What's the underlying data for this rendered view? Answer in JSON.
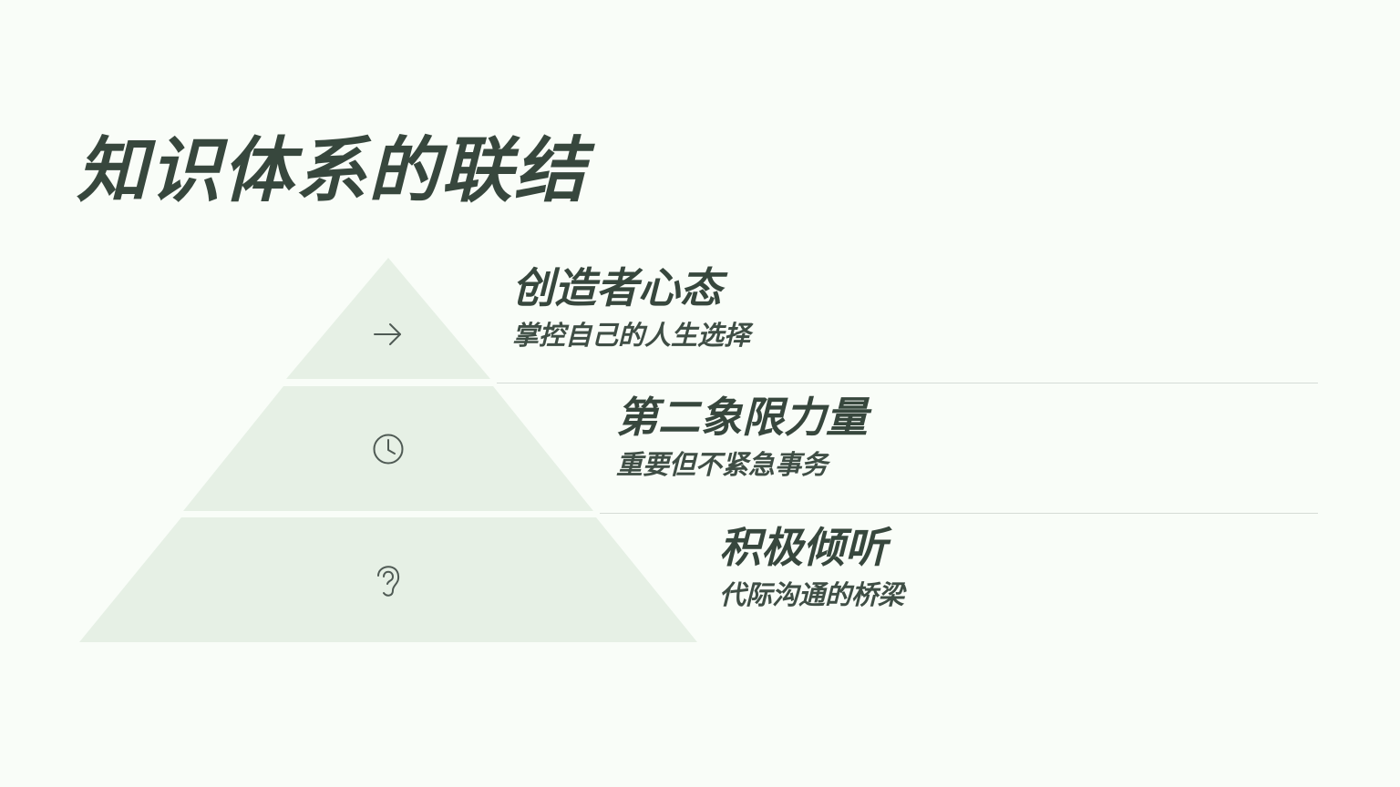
{
  "title": "知识体系的联结",
  "colors": {
    "background": "#f9fdf8",
    "tier_fill": "#e6f0e5",
    "text": "#37473d",
    "icon": "#4f5a54",
    "divider": "#d5dcd6"
  },
  "tiers": [
    {
      "title": "创造者心态",
      "subtitle": "掌控自己的人生选择",
      "icon": "arrow-right-icon"
    },
    {
      "title": "第二象限力量",
      "subtitle": "重要但不紧急事务",
      "icon": "clock-icon"
    },
    {
      "title": "积极倾听",
      "subtitle": "代际沟通的桥梁",
      "icon": "ear-icon"
    }
  ]
}
